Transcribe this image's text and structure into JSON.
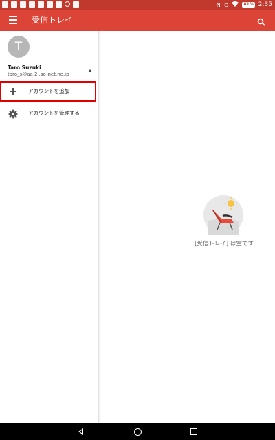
{
  "status_bar": {
    "battery": "81%",
    "time": "2:35",
    "left_icons": [
      "email-notification-icon",
      "image-notification-icon",
      "mail-notification-icon",
      "mail-notification-icon",
      "mail-notification-icon",
      "image-notification-icon",
      "battery-alert-icon",
      "clock-icon",
      "mail-notification-icon"
    ],
    "right_icons": [
      "nfc-icon",
      "do-not-disturb-icon",
      "wifi-icon",
      "battery-icon"
    ]
  },
  "appbar": {
    "title": "受信トレイ",
    "menu_icon": "hamburger-menu-icon",
    "search_icon": "search-icon",
    "color": "#db4437"
  },
  "drawer": {
    "avatar_letter": "T",
    "account_name": "Taro Suzuki",
    "account_email": "taro_s@aa 2 .so-net.ne.jp",
    "items": [
      {
        "label": "アカウントを追加",
        "icon": "plus-icon"
      },
      {
        "label": "アカウントを管理する",
        "icon": "gear-icon"
      }
    ]
  },
  "main": {
    "empty_text": "[受信トレイ] は空です",
    "illustration": "beach-chair-sun-illustration"
  },
  "nav": {
    "buttons": [
      "back-button",
      "home-button",
      "recents-button"
    ]
  }
}
